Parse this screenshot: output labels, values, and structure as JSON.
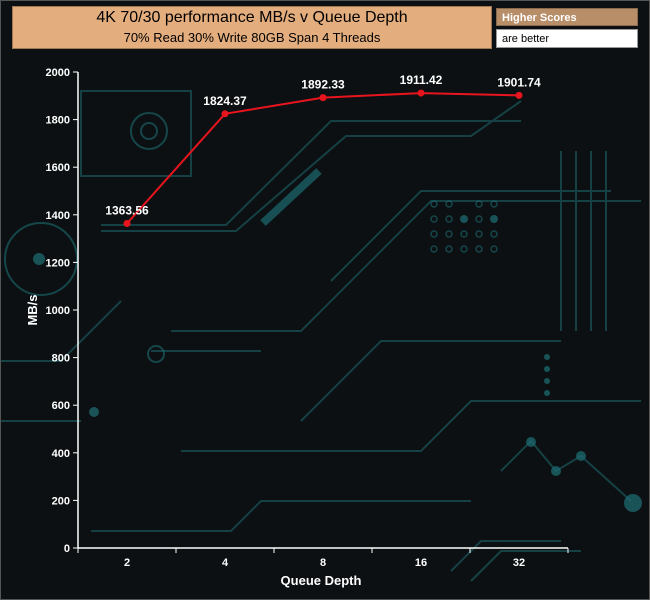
{
  "header": {
    "title": "4K 70/30 performance MB/s v Queue Depth",
    "subtitle": "70% Read 30% Write 80GB Span 4 Threads"
  },
  "note": {
    "line1": "Higher Scores",
    "line2": "are better"
  },
  "colors": {
    "background": "#0c1012",
    "circuit": "#1d6a70",
    "line": "#e8141e",
    "text": "#ffffff",
    "title_box": "#e3ad7e"
  },
  "chart_data": {
    "type": "line",
    "title": "4K 70/30 performance MB/s v Queue Depth",
    "subtitle": "70% Read 30% Write 80GB Span 4 Threads",
    "xlabel": "Queue Depth",
    "ylabel": "MB/s",
    "categories": [
      "2",
      "4",
      "8",
      "16",
      "32"
    ],
    "series": [
      {
        "values": [
          1363.56,
          1824.37,
          1892.33,
          1911.42,
          1901.74
        ]
      }
    ],
    "data_labels": [
      "1363.56",
      "1824.37",
      "1892.33",
      "1911.42",
      "1901.74"
    ],
    "ylim": [
      0,
      2000
    ],
    "yticks": [
      0,
      200,
      400,
      600,
      800,
      1000,
      1200,
      1400,
      1600,
      1800,
      2000
    ],
    "grid": false,
    "legend": "none"
  }
}
